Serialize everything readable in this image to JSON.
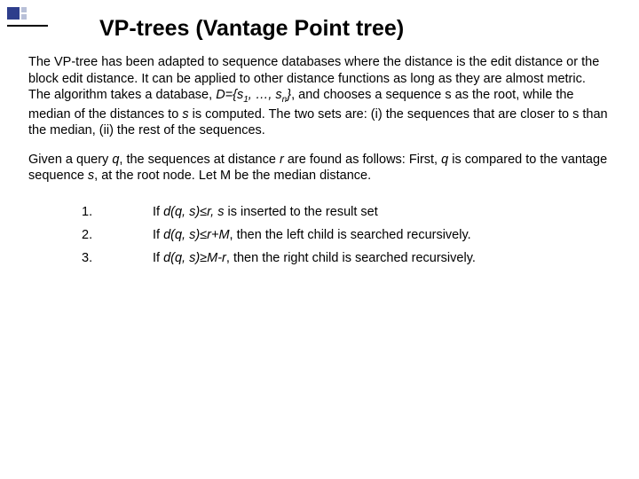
{
  "title": "VP-trees (Vantage Point tree)",
  "para1_a": "The VP-tree has been adapted to sequence databases where the distance is the edit distance or the block edit distance. It can be applied to other distance functions as long as they are almost metric.",
  "para1_b1": "The algorithm takes a database, ",
  "para1_b2": "D={s",
  "para1_b3": "1",
  "para1_b4": ", …, s",
  "para1_b5": "n",
  "para1_b6": "}",
  "para1_b7": ", and chooses a sequence s as the root, while the median of the distances to ",
  "para1_b8": "s",
  "para1_b9": " is computed. The two sets are: (i) the sequences that are closer to s than the median, (ii) the rest of the sequences.",
  "para2_a": "Given a query ",
  "para2_b": "q",
  "para2_c": ", the sequences at distance ",
  "para2_d": "r",
  "para2_e": " are found as follows: First, ",
  "para2_f": "q",
  "para2_g": " is compared to the vantage sequence ",
  "para2_h": "s",
  "para2_i": ", at the root node. Let M be the median distance.",
  "items": [
    {
      "num": "1.",
      "a": "If ",
      "b": "d(q, s)≤r, s",
      "c": " is inserted to the result set"
    },
    {
      "num": "2.",
      "a": "If ",
      "b": "d(q, s)≤r+M",
      "c": ", then the left child is searched recursively."
    },
    {
      "num": "3.",
      "a": "If ",
      "b": "d(q, s)≥M-r",
      "c": ", then the right child is searched recursively."
    }
  ]
}
